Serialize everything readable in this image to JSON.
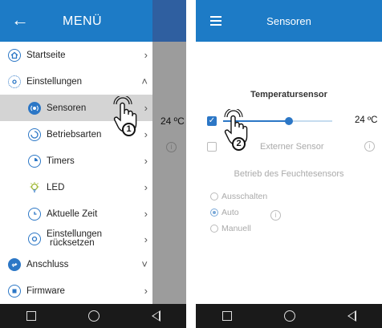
{
  "screen1": {
    "drawer": {
      "title": "MENÜ",
      "back_icon": "back-arrow-icon"
    },
    "menu": [
      {
        "label": "Startseite",
        "icon": "home-icon",
        "chevron": "›"
      },
      {
        "label": "Einstellungen",
        "icon": "settings-icon",
        "chevron": "˄"
      },
      {
        "label": "Sensoren",
        "icon": "sensor-icon",
        "chevron": "›"
      },
      {
        "label": "Betriebsarten",
        "icon": "mode-icon",
        "chevron": "›"
      },
      {
        "label": "Timers",
        "icon": "timer-icon",
        "chevron": "›"
      },
      {
        "label": "LED",
        "icon": "led-icon",
        "chevron": "›"
      },
      {
        "label": "Aktuelle Zeit",
        "icon": "clock-icon",
        "chevron": "›"
      },
      {
        "label": "Einstellungen",
        "label2": "rücksetzen",
        "icon": "reset-icon",
        "chevron": "›"
      },
      {
        "label": "Anschluss",
        "icon": "connection-icon",
        "chevron": "˅"
      },
      {
        "label": "Firmware",
        "icon": "firmware-icon",
        "chevron": "›"
      }
    ],
    "behind": {
      "temperature": "24 ºC",
      "info": "i"
    },
    "step_badge": "1"
  },
  "screen2": {
    "appbar": {
      "title": "Sensoren",
      "menu_icon": "hamburger-icon"
    },
    "temp_sensor": {
      "title": "Temperatursensor",
      "value": "24 ºC",
      "checked": true,
      "slider_fraction": 0.6
    },
    "external_sensor": {
      "label": "Externer Sensor",
      "checked": false,
      "info": "i"
    },
    "humidity": {
      "title": "Betrieb des Feuchtesensors",
      "options": [
        "Ausschalten",
        "Auto",
        "Manuell"
      ],
      "selected": "Auto",
      "info": "i"
    },
    "step_badge": "2"
  },
  "colors": {
    "appbar": "#1d7bc6",
    "accent": "#2c77c6",
    "active_row": "#d4d4d4",
    "navbar": "#1a1a1a"
  }
}
